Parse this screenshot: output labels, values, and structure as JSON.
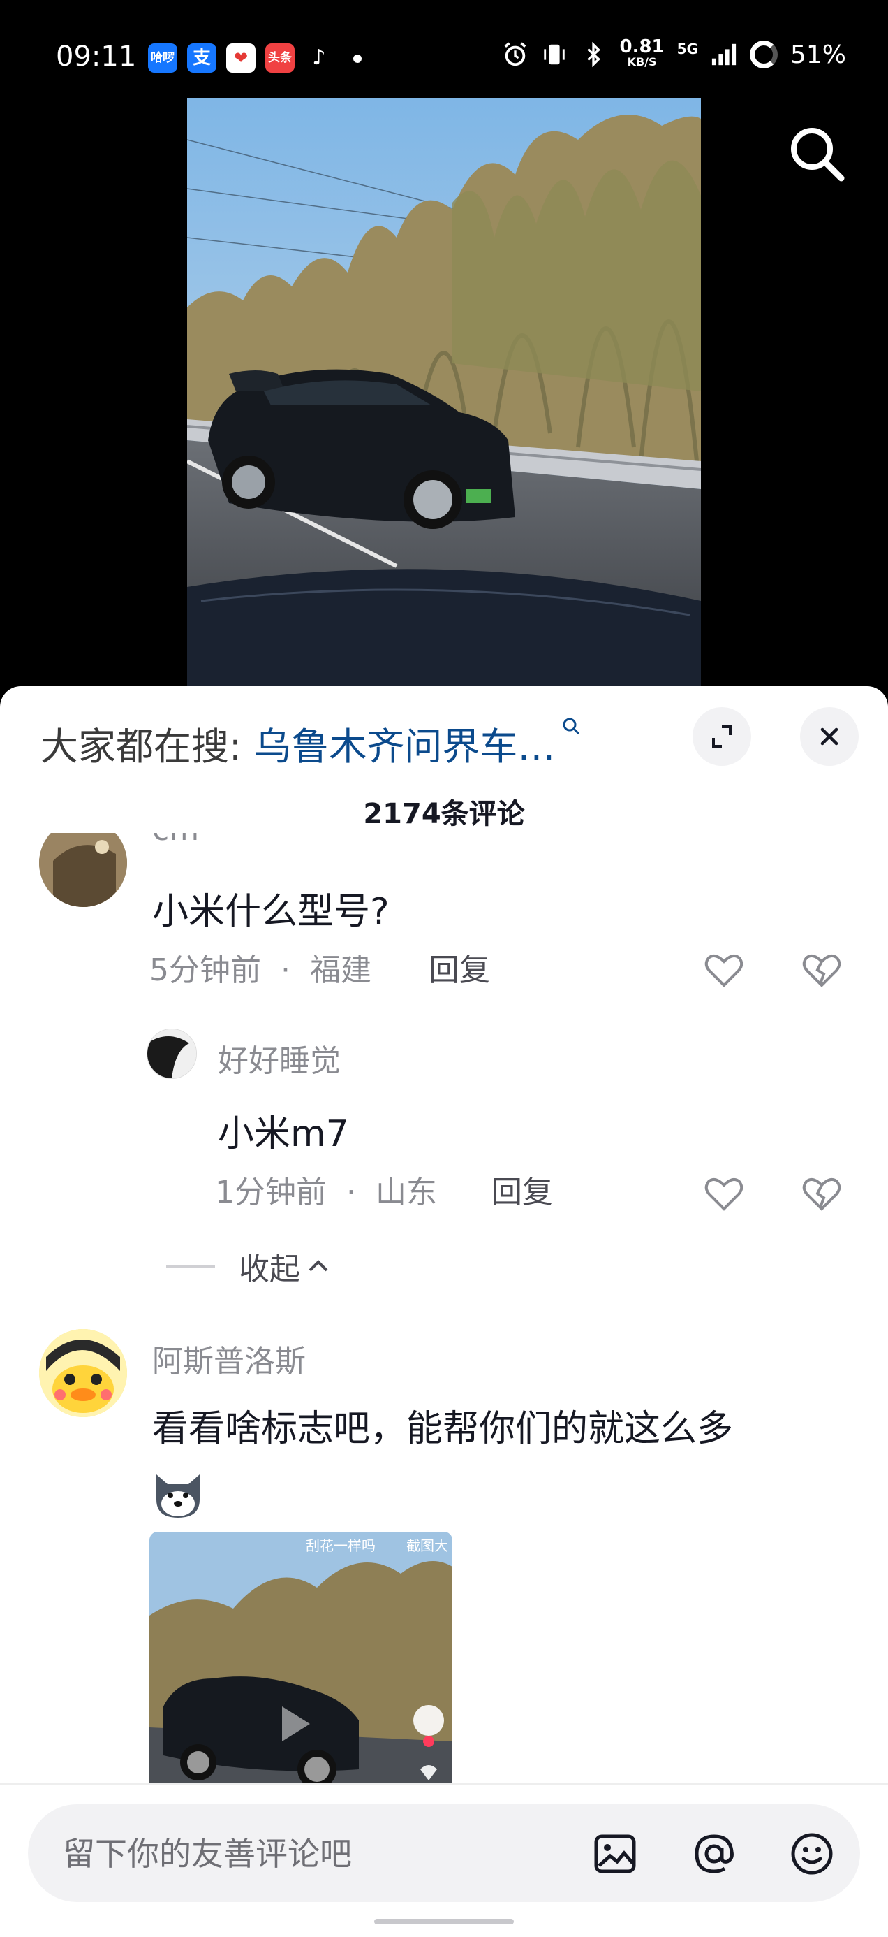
{
  "status_bar": {
    "time": "09:11",
    "apps": [
      {
        "name": "app-icon-haluo",
        "label": "哈啰",
        "color": "#1677ff"
      },
      {
        "name": "app-icon-alipay",
        "label": "支",
        "color": "#1677ff"
      },
      {
        "name": "app-icon-xiaohongshu-like",
        "label": "❤",
        "color": "#ffffff"
      },
      {
        "name": "app-icon-toutiao",
        "label": "头条",
        "color": "#f04142"
      },
      {
        "name": "app-icon-douyin",
        "label": "♪",
        "color": "#000000"
      }
    ],
    "network_speed": "0.81",
    "network_unit": "KB/S",
    "network_type": "5G",
    "battery": "51%"
  },
  "video": {
    "icon": "search-icon"
  },
  "sheet": {
    "hot_search_prefix": "大家都在搜: ",
    "hot_search_term": "乌鲁木齐问界车…",
    "comment_count": "2174条评论"
  },
  "comments": [
    {
      "name": "cm",
      "text": "小米什么型号?",
      "time": "5分钟前",
      "separator": "·",
      "location": "福建",
      "reply_label": "回复"
    },
    {
      "name": "好好睡觉",
      "text": "小米m7",
      "time": "1分钟前",
      "separator": "·",
      "location": "山东",
      "reply_label": "回复"
    },
    {
      "name": "阿斯普洛斯",
      "text": "看看啥标志吧，能帮你们的就这么多",
      "thumb_label_left": "刮花一样吗",
      "thumb_label_right": "截图大"
    }
  ],
  "collapse_label": "收起",
  "input": {
    "placeholder": "留下你的友善评论吧"
  },
  "colors": {
    "accent_link": "#0b4a8c",
    "meta_gray": "#8a8b91"
  }
}
